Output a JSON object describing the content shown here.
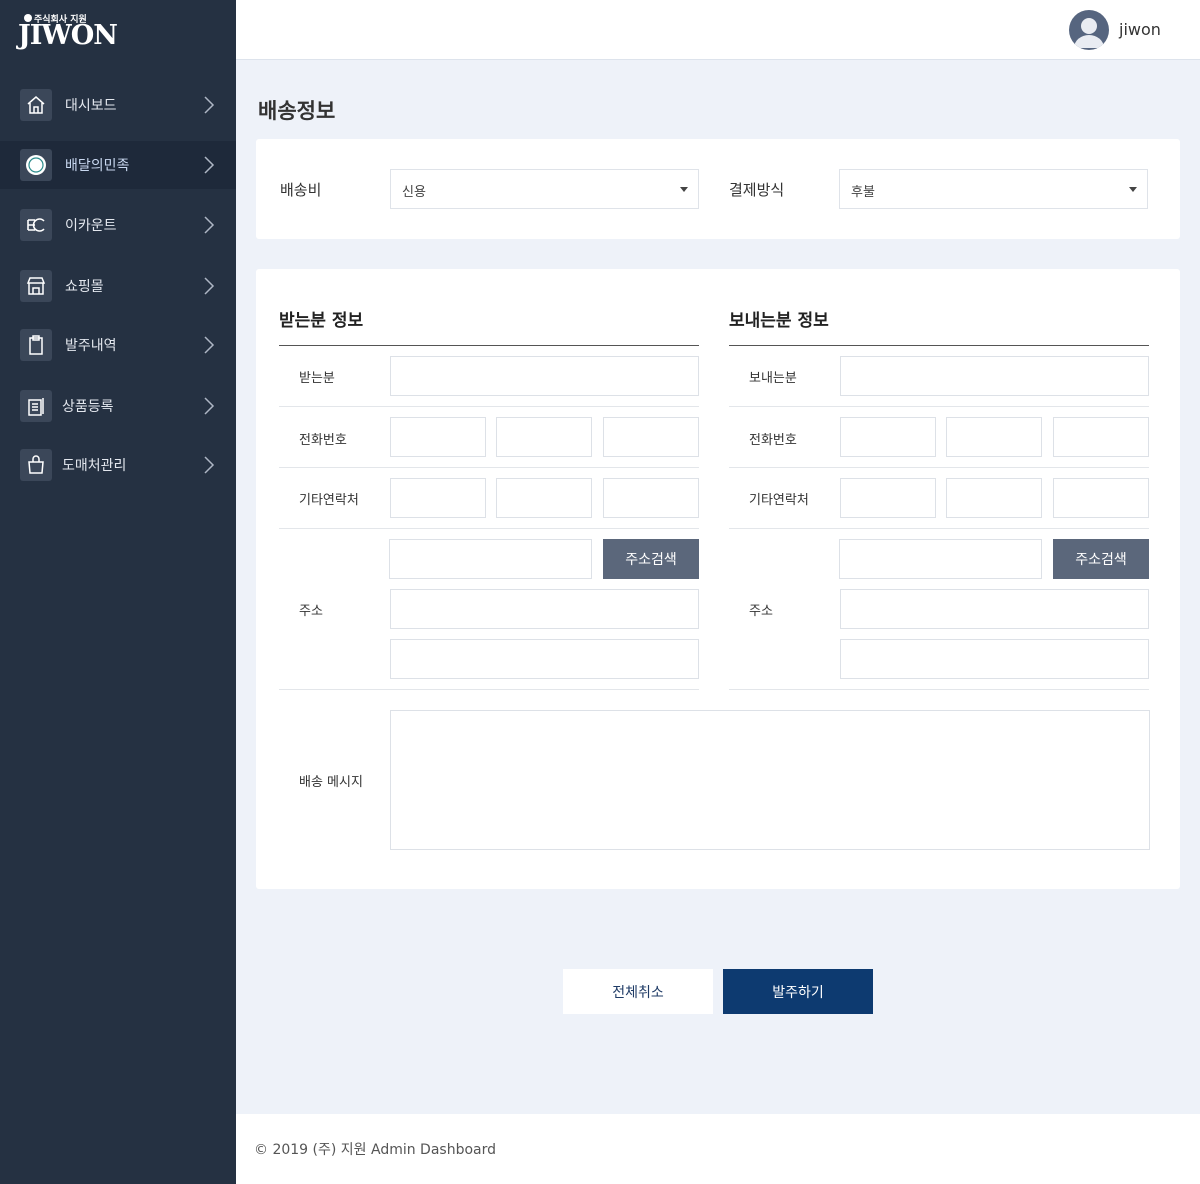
{
  "logo": {
    "small": "주식회사 지원",
    "big": "JIWON"
  },
  "sidebar": {
    "items": [
      {
        "label": "대시보드",
        "icon": "home-icon",
        "active": false
      },
      {
        "label": "배달의민족",
        "icon": "baemin-icon",
        "active": true
      },
      {
        "label": "이카운트",
        "icon": "ecount-icon",
        "active": false
      },
      {
        "label": "쇼핑몰",
        "icon": "store-icon",
        "active": false
      },
      {
        "label": "발주내역",
        "icon": "clipboard-icon",
        "active": false
      },
      {
        "label": "상품등록",
        "icon": "product-register-icon",
        "active": false
      },
      {
        "label": "도매처관리",
        "icon": "shopping-bag-icon",
        "active": false
      }
    ]
  },
  "header": {
    "username": "jiwon"
  },
  "page": {
    "title": "배송정보"
  },
  "shipping": {
    "fee_label": "배송비",
    "fee_value": "신용",
    "payment_label": "결제방식",
    "payment_value": "후불"
  },
  "receiver": {
    "title": "받는분 정보",
    "name_label": "받는분",
    "phone_label": "전화번호",
    "other_label": "기타연락처",
    "address_label": "주소",
    "search_button": "주소검색"
  },
  "sender": {
    "title": "보내는분 정보",
    "name_label": "보내는분",
    "phone_label": "전화번호",
    "other_label": "기타연락처",
    "address_label": "주소",
    "search_button": "주소검색"
  },
  "message": {
    "label": "배송 메시지"
  },
  "actions": {
    "cancel": "전체취소",
    "order": "발주하기"
  },
  "footer": {
    "text": "© 2019 (주) 지원 Admin Dashboard"
  }
}
